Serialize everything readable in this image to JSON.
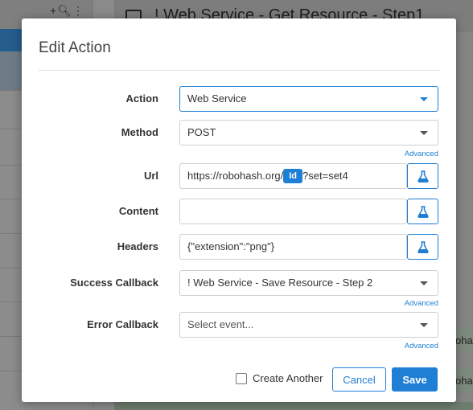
{
  "background": {
    "header_title": "! Web Service - Get Resource - Step1",
    "left_tools": "+🔍︎⋮",
    "right_partial_texts": [
      "oha",
      "oha"
    ]
  },
  "dialog": {
    "title": "Edit Action",
    "fields": {
      "action": {
        "label": "Action",
        "value": "Web Service"
      },
      "method": {
        "label": "Method",
        "value": "POST",
        "advanced": "Advanced"
      },
      "url": {
        "label": "Url",
        "prefix": "https://robohash.org/",
        "tag": "Id",
        "suffix": "?set=set4"
      },
      "content": {
        "label": "Content",
        "value": ""
      },
      "headers": {
        "label": "Headers",
        "value": "{\"extension\":\"png\"}"
      },
      "success_callback": {
        "label": "Success Callback",
        "value": "! Web Service - Save Resource - Step 2",
        "advanced": "Advanced"
      },
      "error_callback": {
        "label": "Error Callback",
        "placeholder": "Select event...",
        "advanced": "Advanced"
      }
    },
    "footer": {
      "create_another_label": "Create Another",
      "create_another_checked": false,
      "cancel_label": "Cancel",
      "save_label": "Save"
    },
    "colors": {
      "accent": "#1f7fd4"
    }
  }
}
